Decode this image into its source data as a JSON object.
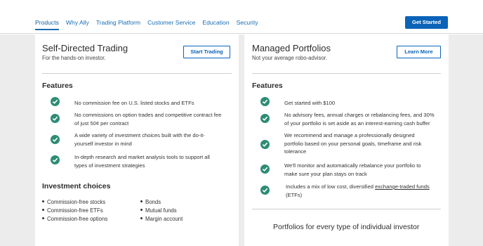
{
  "nav": {
    "tabs": [
      "Products",
      "Why Ally",
      "Trading Platform",
      "Customer Service",
      "Education",
      "Security"
    ],
    "get_started": "Get Started"
  },
  "left": {
    "title": "Self-Directed Trading",
    "subtitle": "For the hands-on investor.",
    "button": "Start Trading",
    "features_title": "Features",
    "features": [
      [
        "No commission fee on U.S. listed stocks and ETFs"
      ],
      [
        "No commissions on option trades and competitive contract fee",
        "of just 50¢ per contract"
      ],
      [
        "A wide variety of investment choices built with the do-it-",
        "yourself investor in mind"
      ],
      [
        "In-depth research and market analysis tools to support all",
        "types of investment strategies"
      ]
    ],
    "choices_title": "Investment choices",
    "choices_col1": [
      "Commission-free stocks",
      "Commission-free ETFs",
      "Commission-free options"
    ],
    "choices_col2": [
      "Bonds",
      "Mutual funds",
      "Margin account"
    ]
  },
  "right": {
    "title": "Managed Portfolios",
    "subtitle": "Not your average robo-advisor.",
    "button": "Learn More",
    "features_title": "Features",
    "features": [
      [
        "Get started with $100"
      ],
      [
        "No advisory fees, annual charges or rebalancing fees, and 30%",
        "of your portfolio is set aside as an interest-earning cash buffer"
      ],
      [
        "We recommend and manage a professionally designed",
        "portfolio based on your personal goals, timeframe and risk",
        "tolerance"
      ],
      [
        "We'll monitor and automatically rebalance your portfolio to",
        "make sure your plan stays on track"
      ]
    ],
    "last_feature_pre": "Includes a mix of low cost, diversified",
    "last_feature_link": "exchange-traded funds",
    "last_feature_post": "(ETFs)",
    "bottom_heading": "Portfolios for every type of individual investor"
  },
  "colors": {
    "brand_blue": "#0b63b8",
    "check_green": "#2e8c74",
    "backdrop": "#ececec"
  },
  "icons": {
    "feature_check": "check-circle-icon"
  }
}
